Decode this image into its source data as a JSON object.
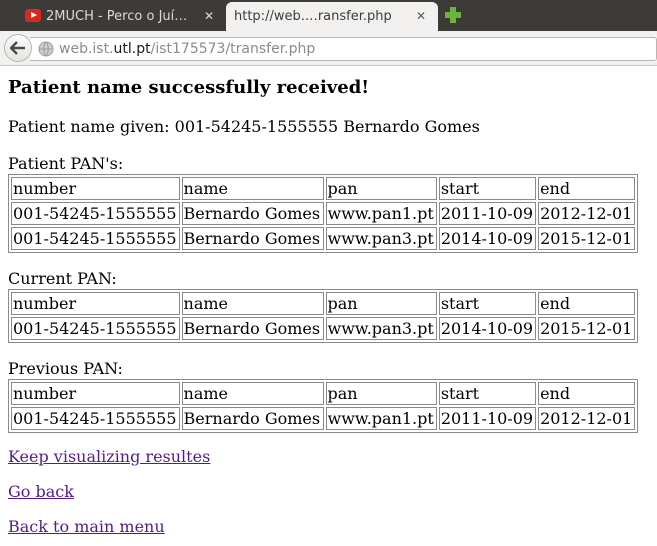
{
  "browser": {
    "tabs": [
      {
        "title": "2MUCH - Perco o Juí…",
        "icon": "youtube-icon"
      },
      {
        "title": "http://web.…ransfer.php",
        "icon": ""
      }
    ],
    "new_tab_icon": "plus-icon",
    "url_domain_prefix": "web.ist.",
    "url_domain": "utl.pt",
    "url_path": "/ist175573/transfer.php"
  },
  "page": {
    "heading": "Patient name successfully received!",
    "given_label": "Patient name given: 001-54245-1555555 Bernardo Gomes",
    "patient_pans": {
      "label": "Patient PAN's:",
      "headers": [
        "number",
        "name",
        "pan",
        "start",
        "end"
      ],
      "rows": [
        [
          "001-54245-1555555",
          "Bernardo Gomes",
          "www.pan1.pt",
          "2011-10-09",
          "2012-12-01"
        ],
        [
          "001-54245-1555555",
          "Bernardo Gomes",
          "www.pan3.pt",
          "2014-10-09",
          "2015-12-01"
        ]
      ]
    },
    "current_pan": {
      "label": "Current PAN:",
      "headers": [
        "number",
        "name",
        "pan",
        "start",
        "end"
      ],
      "rows": [
        [
          "001-54245-1555555",
          "Bernardo Gomes",
          "www.pan3.pt",
          "2014-10-09",
          "2015-12-01"
        ]
      ]
    },
    "previous_pan": {
      "label": "Previous PAN:",
      "headers": [
        "number",
        "name",
        "pan",
        "start",
        "end"
      ],
      "rows": [
        [
          "001-54245-1555555",
          "Bernardo Gomes",
          "www.pan1.pt",
          "2011-10-09",
          "2012-12-01"
        ]
      ]
    },
    "links": [
      "Keep visualizing resultes",
      "Go back",
      "Back to main menu"
    ]
  },
  "colors": {
    "tabbar": "#3c3b37",
    "active_tab": "#f2f1f0",
    "visited_link": "#551a8b",
    "youtube_red": "#d9291f",
    "new_tab_green": "#6ab43e"
  }
}
